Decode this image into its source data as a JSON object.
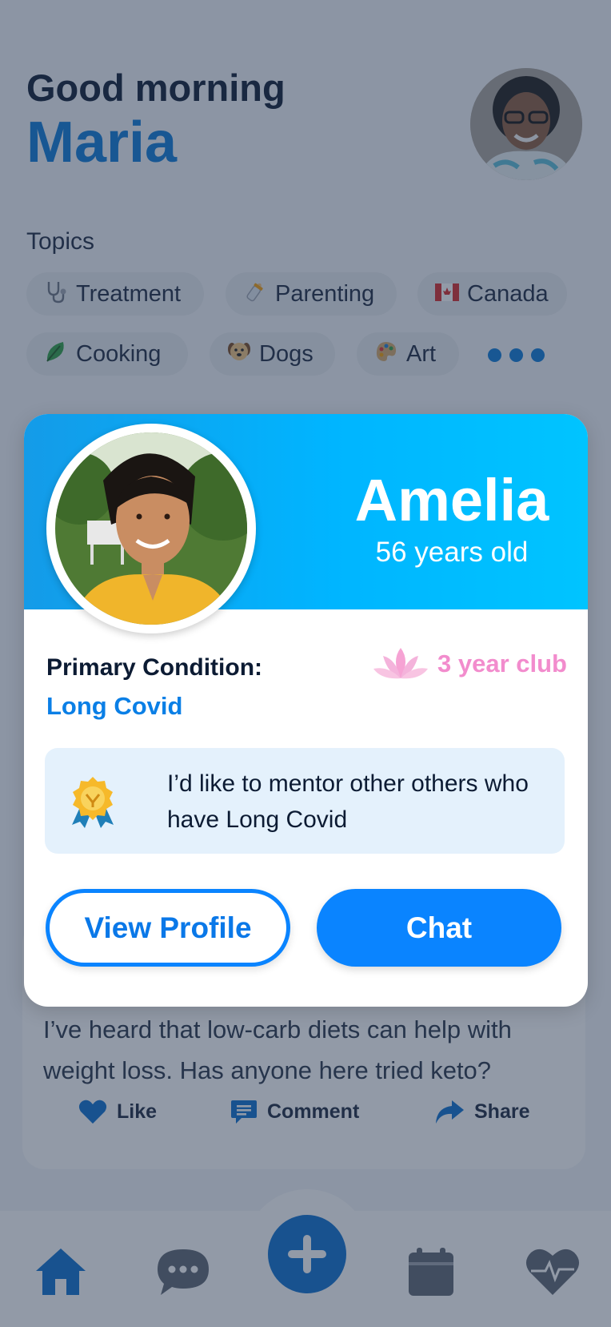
{
  "header": {
    "greeting": "Good morning",
    "user_name": "Maria",
    "avatar_alt": "Maria profile photo"
  },
  "topics": {
    "label": "Topics",
    "chips": [
      {
        "label": "Treatment",
        "icon": "stethoscope-icon"
      },
      {
        "label": "Parenting",
        "icon": "baby-bottle-icon"
      },
      {
        "label": "Canada",
        "icon": "canada-flag-icon"
      },
      {
        "label": "Cooking",
        "icon": "leafy-green-icon"
      },
      {
        "label": "Dogs",
        "icon": "dog-face-icon"
      },
      {
        "label": "Art",
        "icon": "palette-icon"
      }
    ],
    "more_icon": "more-dots-icon"
  },
  "post": {
    "text": "I’ve heard that low-carb diets can help with weight loss. Has anyone here tried keto?",
    "actions": [
      {
        "label": "Like",
        "icon": "heart-icon"
      },
      {
        "label": "Comment",
        "icon": "comment-icon"
      },
      {
        "label": "Share",
        "icon": "share-icon"
      }
    ]
  },
  "mentor_card": {
    "name": "Amelia",
    "age": "56 years old",
    "condition_label": "Primary Condition:",
    "condition_value": "Long Covid",
    "club_badge": "3 year club",
    "mentor_statement": "I’d like to mentor other others who have Long Covid",
    "view_profile_label": "View Profile",
    "chat_label": "Chat"
  },
  "tabbar": {
    "tabs": [
      "home-icon",
      "chat-bubble-icon",
      "add-icon",
      "calendar-icon",
      "heart-rate-icon"
    ],
    "active": "home-icon"
  },
  "colors": {
    "primary": "#0a84ff",
    "header_gradient_start": "#149be8",
    "header_gradient_end": "#00c4ff",
    "club_pink": "#f28ccd",
    "quote_bg": "#e4f1fc"
  }
}
